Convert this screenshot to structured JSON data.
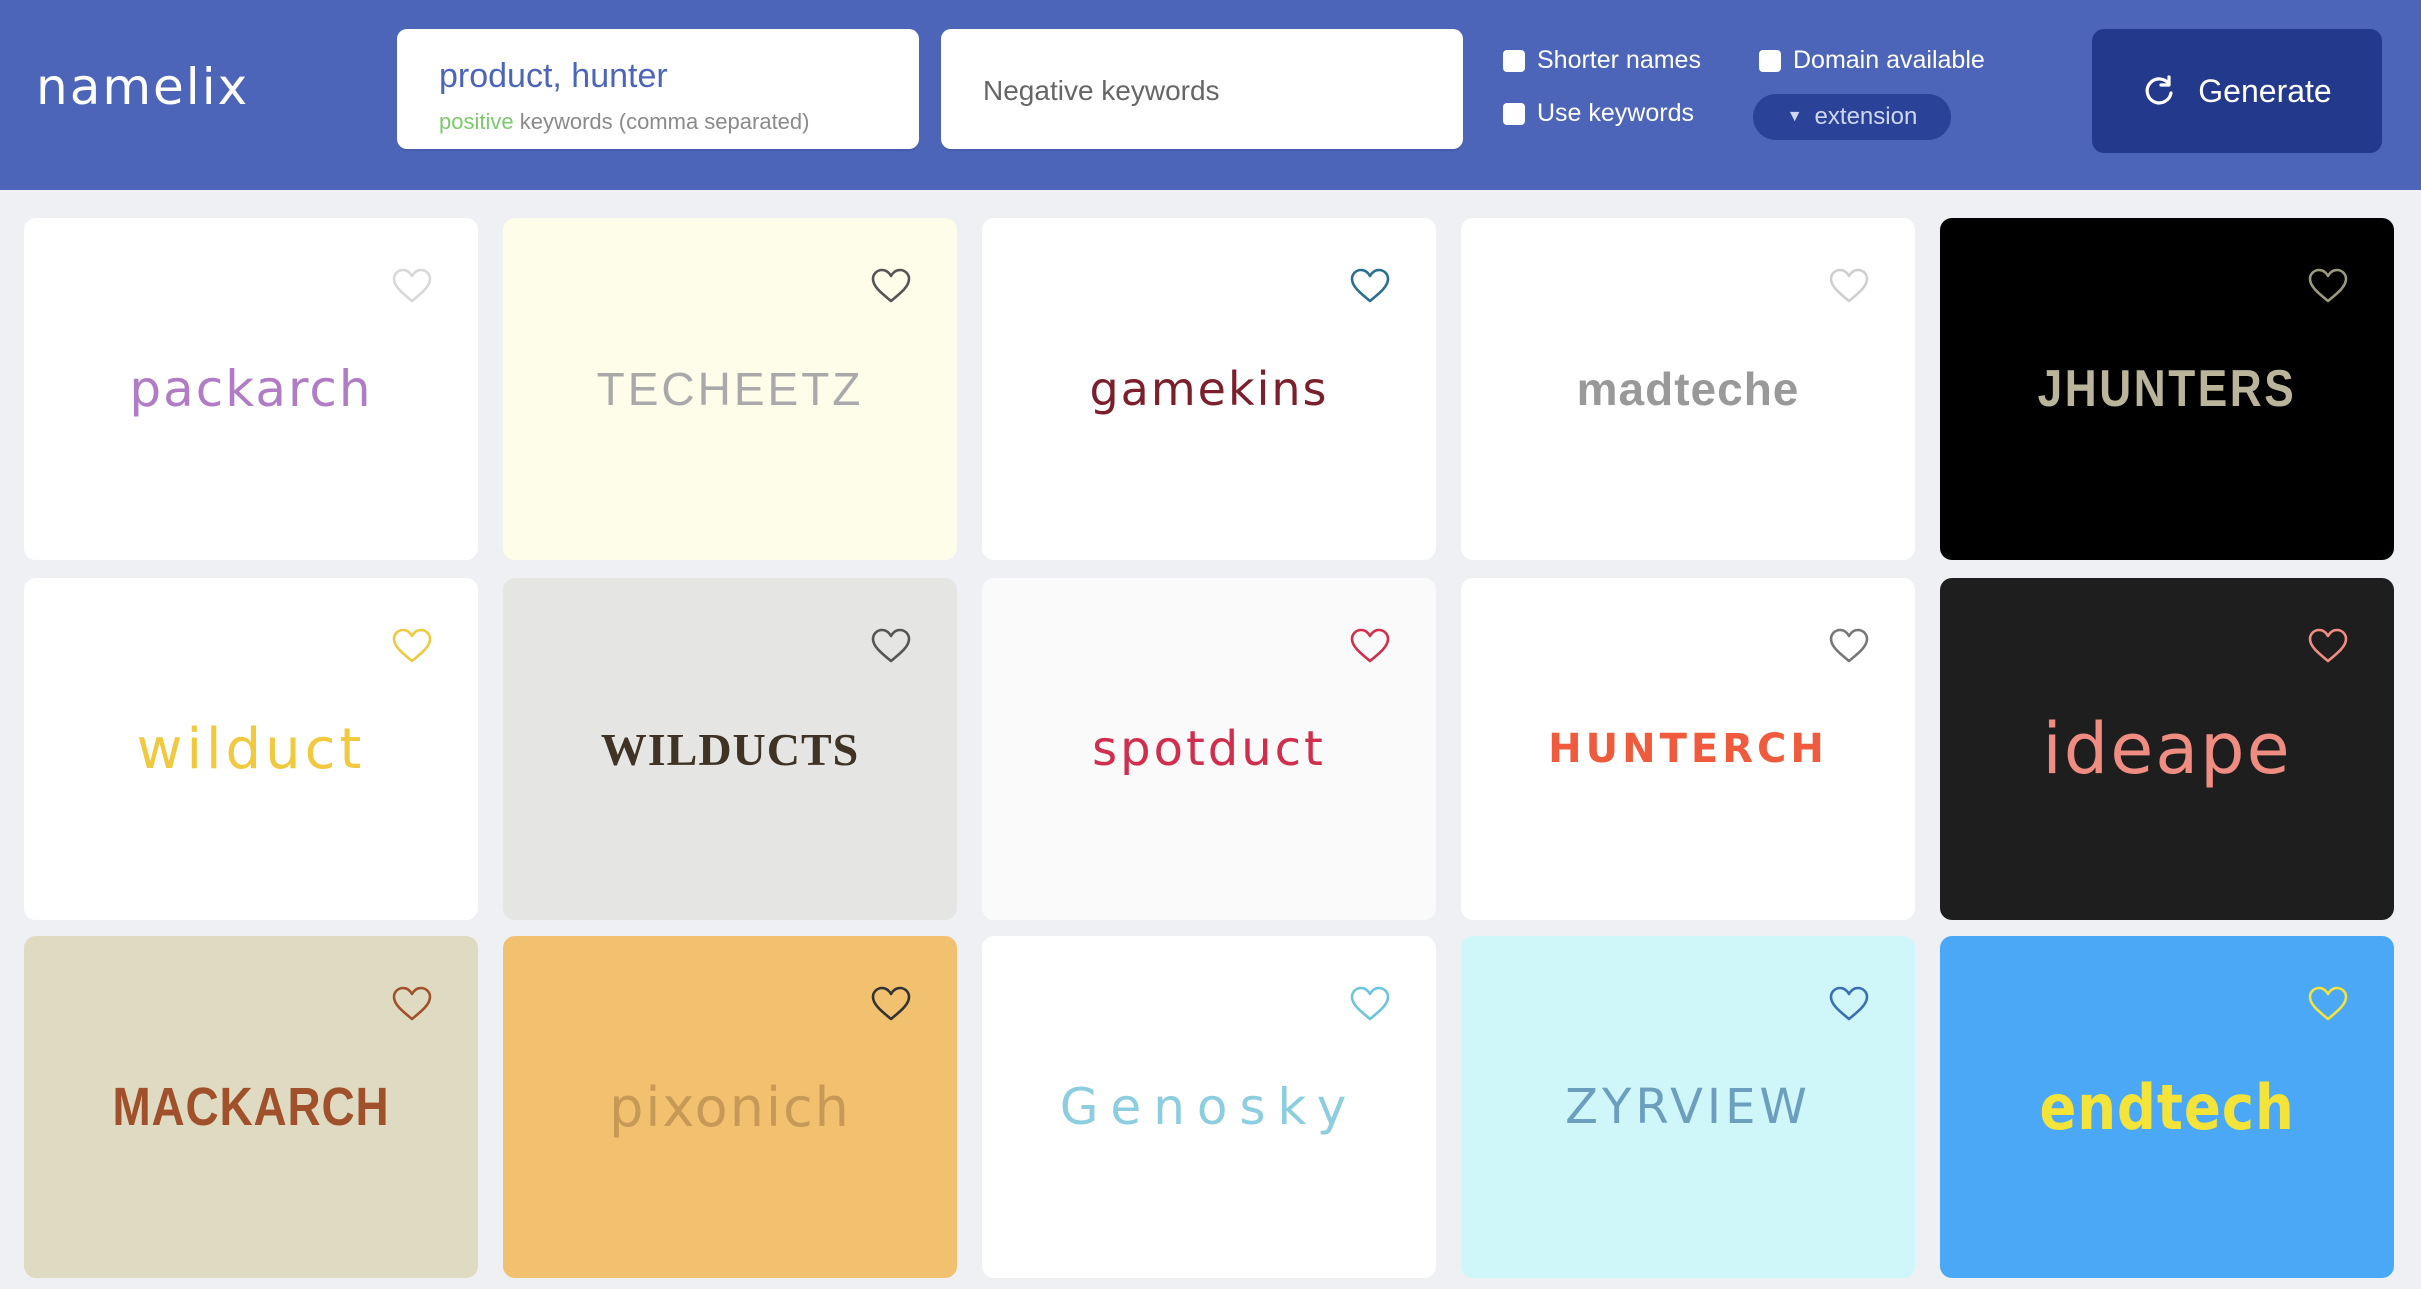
{
  "header": {
    "logo": "namelix",
    "positive_value": "product, hunter",
    "positive_help_green": "positive",
    "positive_help_rest": " keywords (comma separated)",
    "negative_placeholder": "Negative keywords",
    "opt_shorter": "Shorter names",
    "opt_usekw": "Use keywords",
    "opt_domain": "Domain available",
    "extension_label": "extension",
    "generate_label": "Generate"
  },
  "cards": [
    {
      "name": "packarch",
      "bg": "#ffffff",
      "color": "#b07cc6",
      "heart": "#d8d8d8"
    },
    {
      "name": "TECHEETZ",
      "bg": "#fdfde9",
      "color": "#a9a9a9",
      "heart": "#555555"
    },
    {
      "name": "gamekins",
      "bg": "#ffffff",
      "color": "#7a1f2b",
      "heart": "#2a6f8f"
    },
    {
      "name": "madteche",
      "bg": "#ffffff",
      "color": "#999999",
      "heart": "#cfcfcf"
    },
    {
      "name": "JHUNTERS",
      "bg": "#000000",
      "color": "#b9b49a",
      "heart": "#9c9a7c"
    },
    {
      "name": "wilduct",
      "bg": "#ffffff",
      "color": "#f0c93f",
      "heart": "#f0c93f"
    },
    {
      "name": "WILDUCTS",
      "bg": "#e5e5e3",
      "color": "#3e3324",
      "heart": "#555555"
    },
    {
      "name": "spotduct",
      "bg": "#fafafa",
      "color": "#d12e4e",
      "heart": "#d12e4e"
    },
    {
      "name": "HUNTERCH",
      "bg": "#ffffff",
      "color": "#ef5b3c",
      "heart": "#777777"
    },
    {
      "name": "ideape",
      "bg": "#1f1e1f",
      "color": "#f08d82",
      "heart": "#f08d82"
    },
    {
      "name": "MACKARCH",
      "bg": "#dfdbc3",
      "color": "#a0502a",
      "heart": "#a0502a"
    },
    {
      "name": "pixonich",
      "bg": "#f1c16f",
      "color": "#c69a56",
      "heart": "#333333"
    },
    {
      "name": "Genosky",
      "bg": "#ffffff",
      "color": "#8ccde0",
      "heart": "#6cc5dc"
    },
    {
      "name": "ZYRVIEW",
      "bg": "#cff6f8",
      "color": "#6c9fbf",
      "heart": "#3a6fb5"
    },
    {
      "name": "endtech",
      "bg": "#4aa8f6",
      "color": "#f4e43a",
      "heart": "#f4e43a"
    }
  ]
}
